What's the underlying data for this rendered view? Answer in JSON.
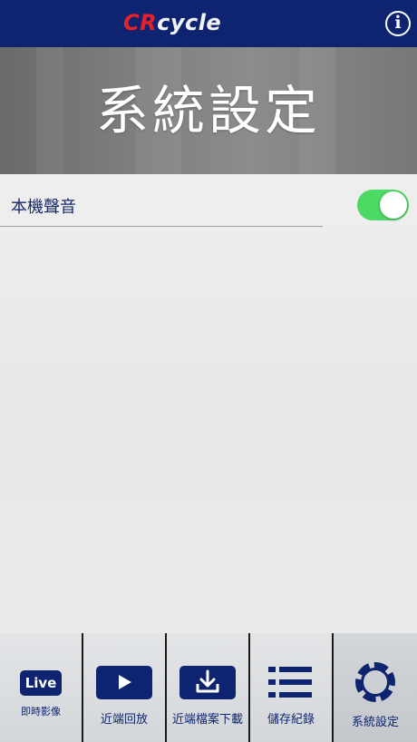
{
  "header": {
    "logo_cr": "CR",
    "logo_cycle": "cycle",
    "info_glyph": "i"
  },
  "banner": {
    "title": "系統設定"
  },
  "settings": {
    "items": [
      {
        "label": "本機聲音",
        "enabled": true
      }
    ]
  },
  "tabbar": {
    "tabs": [
      {
        "label": "即時影像",
        "icon": "live-icon",
        "icon_text": "Live",
        "active": false
      },
      {
        "label": "近端回放",
        "icon": "play-icon",
        "active": false
      },
      {
        "label": "近端檔案下載",
        "icon": "download-icon",
        "active": false
      },
      {
        "label": "儲存紀錄",
        "icon": "list-icon",
        "active": false
      },
      {
        "label": "系統設定",
        "icon": "tire-icon",
        "active": true
      }
    ]
  },
  "colors": {
    "navy": "#0e2470",
    "brand_red": "#e8202a",
    "toggle_on": "#4cd964"
  }
}
